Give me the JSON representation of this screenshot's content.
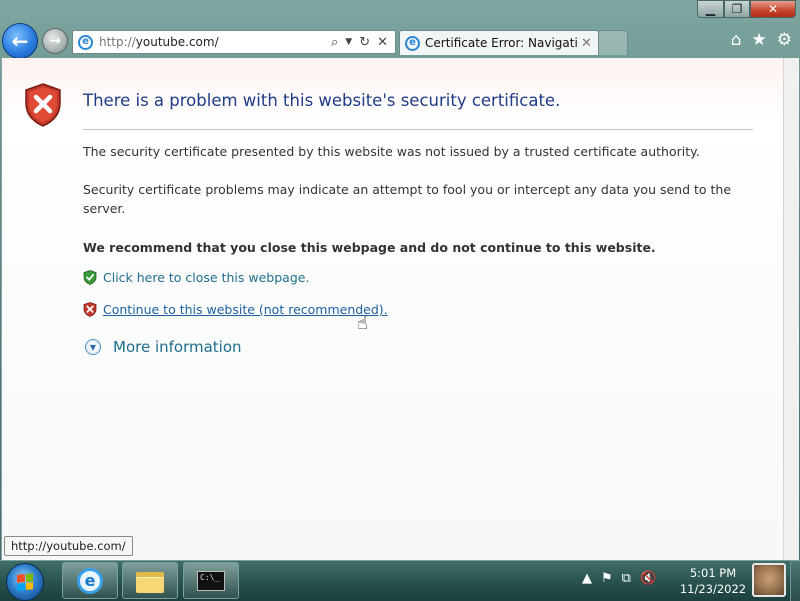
{
  "browser": {
    "address": {
      "protocol": "http://",
      "domain": "youtube.com/"
    },
    "tab": {
      "title": "Certificate Error: Navigation..."
    }
  },
  "page": {
    "heading": "There is a problem with this website's security certificate.",
    "paragraph1": "The security certificate presented by this website was not issued by a trusted certificate authority.",
    "paragraph2": "Security certificate problems may indicate an attempt to fool you or intercept any data you send to the server.",
    "recommendation": "We recommend that you close this webpage and do not continue to this website.",
    "close_link": "Click here to close this webpage.",
    "continue_link": "Continue to this website (not recommended).",
    "more_info": "More information"
  },
  "status_tooltip": "http://youtube.com/",
  "taskbar": {
    "clock_time": "5:01 PM",
    "clock_date": "11/23/2022",
    "cmd_icon_text": "C:\\_"
  },
  "colors": {
    "heading": "#1f3c88",
    "link": "#1f6e8c",
    "error_red": "#c8432a",
    "safe_green": "#3a9a3a"
  }
}
